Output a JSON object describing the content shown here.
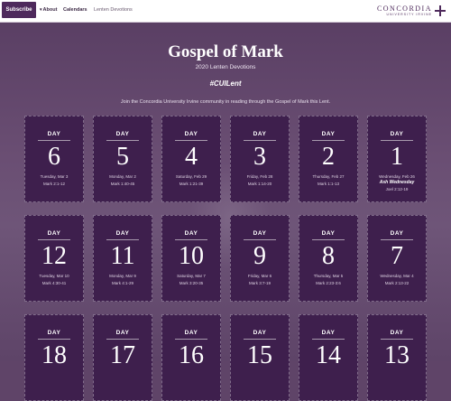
{
  "nav": {
    "subscribe_label": "Subscribe",
    "about_label": "About",
    "calendars_label": "Calendars",
    "lenten_label": "Lenten Devotions",
    "logo_name": "CONCORDIA",
    "logo_sub": "UNIVERSITY IRVINE",
    "logo_icon": "cross-icon"
  },
  "header": {
    "title": "Gospel of Mark",
    "subtitle": "2020 Lenten Devotions",
    "hashtag": "#CUILent",
    "intro": "Join the Concordia University Irvine community in reading through the Gospel of Mark this Lent."
  },
  "day_label": "DAY",
  "cards": [
    {
      "num": "1",
      "date": "Wednesday, Feb 26",
      "special": "Ash Wednesday",
      "verse": "Joel 2:12-19"
    },
    {
      "num": "2",
      "date": "Thursday, Feb 27",
      "verse": "Mark 1:1-13"
    },
    {
      "num": "3",
      "date": "Friday, Feb 28",
      "verse": "Mark 1:14-20"
    },
    {
      "num": "4",
      "date": "Saturday, Feb 29",
      "verse": "Mark 1:21-39"
    },
    {
      "num": "5",
      "date": "Monday, Mar 2",
      "verse": "Mark 1:40-45"
    },
    {
      "num": "6",
      "date": "Tuesday, Mar 3",
      "verse": "Mark 2:1-12"
    },
    {
      "num": "7",
      "date": "Wednesday, Mar 4",
      "verse": "Mark 2:13-22"
    },
    {
      "num": "8",
      "date": "Thursday, Mar 5",
      "verse": "Mark 2:23-3:6"
    },
    {
      "num": "9",
      "date": "Friday, Mar 6",
      "verse": "Mark 3:7-19"
    },
    {
      "num": "10",
      "date": "Saturday, Mar 7",
      "verse": "Mark 3:20-35"
    },
    {
      "num": "11",
      "date": "Monday, Mar 9",
      "verse": "Mark 4:1-29"
    },
    {
      "num": "12",
      "date": "Tuesday, Mar 10",
      "verse": "Mark 4:30-41"
    },
    {
      "num": "13"
    },
    {
      "num": "14"
    },
    {
      "num": "15"
    },
    {
      "num": "16"
    },
    {
      "num": "17"
    },
    {
      "num": "18"
    }
  ]
}
